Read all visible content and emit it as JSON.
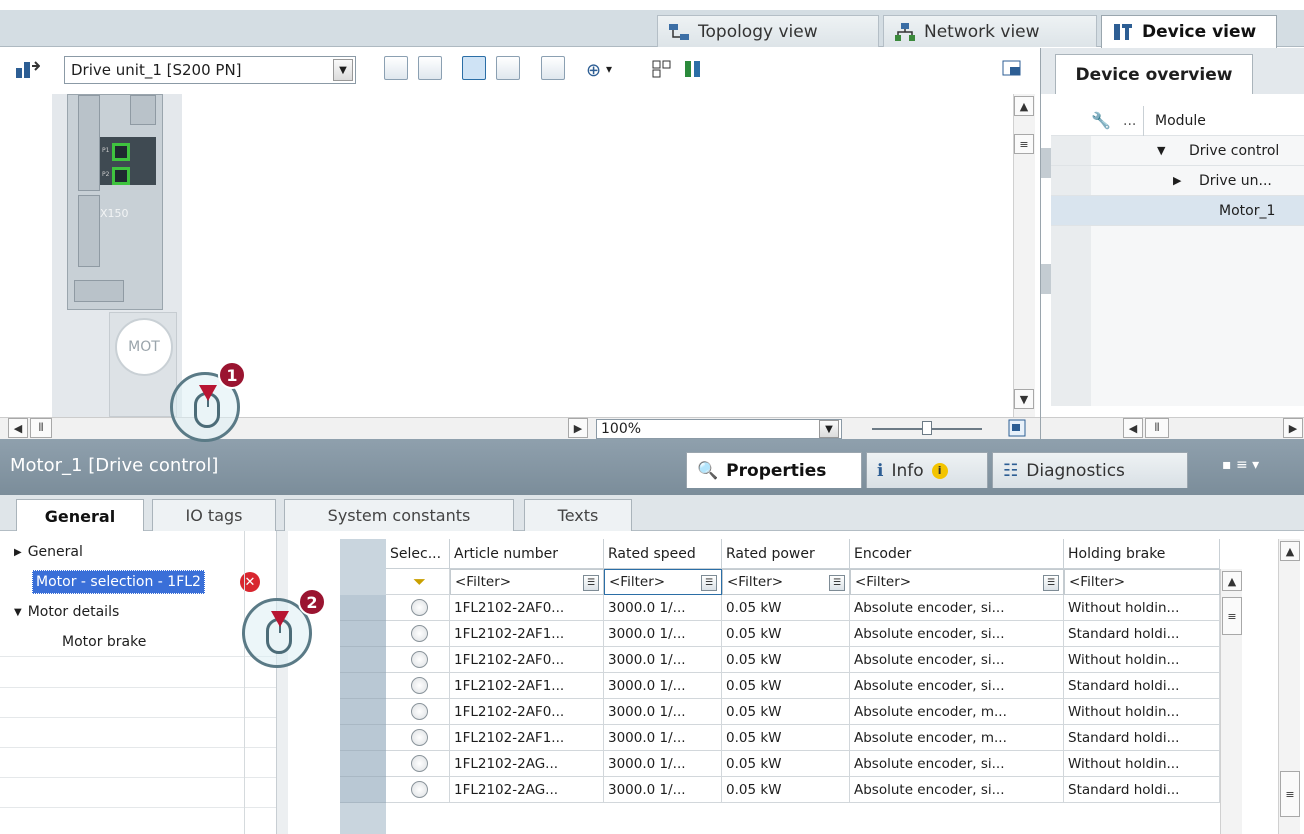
{
  "view_tabs": {
    "topology": "Topology view",
    "network": "Network view",
    "device": "Device view"
  },
  "toolbar": {
    "device_select": "Drive unit_1 [S200 PN]"
  },
  "canvas": {
    "module_label": "X150",
    "port1": "P1",
    "port2": "P2",
    "motor_label": "MOT"
  },
  "zoom": {
    "value": "100%"
  },
  "device_overview": {
    "tab": "Device overview",
    "col_dots": "...",
    "col_module": "Module",
    "rows": [
      {
        "label": "Drive control"
      },
      {
        "label": "Drive un..."
      },
      {
        "label": "Motor_1"
      }
    ]
  },
  "properties_header": {
    "title": "Motor_1 [Drive control]",
    "tab_properties": "Properties",
    "tab_info": "Info",
    "tab_diagnostics": "Diagnostics"
  },
  "subtabs": {
    "general": "General",
    "io_tags": "IO tags",
    "system_constants": "System constants",
    "texts": "Texts"
  },
  "nav": {
    "general": "General",
    "motor_selection": "Motor - selection - 1FL2",
    "motor_details": "Motor details",
    "motor_brake": "Motor brake"
  },
  "table": {
    "columns": [
      "Selec...",
      "Article number",
      "Rated speed",
      "Rated power",
      "Encoder",
      "Holding brake"
    ],
    "filter": "<Filter>",
    "rows": [
      {
        "article": "1FL2102-2AF0...",
        "speed": "3000.0 1/...",
        "power": "0.05 kW",
        "encoder": "Absolute encoder, si...",
        "brake": "Without holdin..."
      },
      {
        "article": "1FL2102-2AF1...",
        "speed": "3000.0 1/...",
        "power": "0.05 kW",
        "encoder": "Absolute encoder, si...",
        "brake": "Standard holdi..."
      },
      {
        "article": "1FL2102-2AF0...",
        "speed": "3000.0 1/...",
        "power": "0.05 kW",
        "encoder": "Absolute encoder, si...",
        "brake": "Without holdin..."
      },
      {
        "article": "1FL2102-2AF1...",
        "speed": "3000.0 1/...",
        "power": "0.05 kW",
        "encoder": "Absolute encoder, si...",
        "brake": "Standard holdi..."
      },
      {
        "article": "1FL2102-2AF0...",
        "speed": "3000.0 1/...",
        "power": "0.05 kW",
        "encoder": "Absolute encoder, m...",
        "brake": "Without holdin..."
      },
      {
        "article": "1FL2102-2AF1...",
        "speed": "3000.0 1/...",
        "power": "0.05 kW",
        "encoder": "Absolute encoder, m...",
        "brake": "Standard holdi..."
      },
      {
        "article": "1FL2102-2AG...",
        "speed": "3000.0 1/...",
        "power": "0.05 kW",
        "encoder": "Absolute encoder, si...",
        "brake": "Without holdin..."
      },
      {
        "article": "1FL2102-2AG...",
        "speed": "3000.0 1/...",
        "power": "0.05 kW",
        "encoder": "Absolute encoder, si...",
        "brake": "Standard holdi..."
      }
    ]
  },
  "callouts": {
    "step1": "1",
    "step2": "2"
  },
  "colors": {
    "selection_blue": "#3a6fd8",
    "callout_red": "#9a1430",
    "port_green": "#3fc43f"
  }
}
